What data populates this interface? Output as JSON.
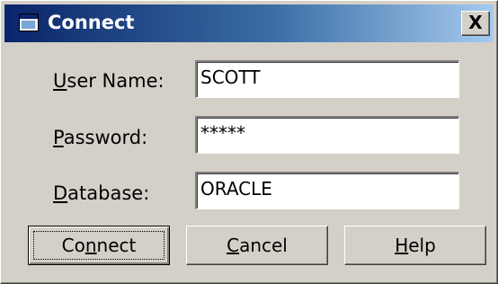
{
  "window": {
    "title": "Connect",
    "close_glyph": "X",
    "title_icon": "window-app-icon",
    "close_icon": "close-icon"
  },
  "form": {
    "username": {
      "label_accel": "U",
      "label_rest": "ser Name:",
      "value": "SCOTT"
    },
    "password": {
      "label_accel": "P",
      "label_rest": "assword:",
      "value": "*****"
    },
    "database": {
      "label_accel": "D",
      "label_rest": "atabase:",
      "value": "ORACLE"
    }
  },
  "buttons": {
    "connect": {
      "pre": "Co",
      "accel": "n",
      "post": "nect"
    },
    "cancel": {
      "pre": "",
      "accel": "C",
      "post": "ancel"
    },
    "help": {
      "pre": "",
      "accel": "H",
      "post": "elp"
    }
  },
  "colors": {
    "titlebar_start": "#0a246a",
    "titlebar_end": "#a6caf0",
    "dialog_face": "#d4d0c8"
  }
}
